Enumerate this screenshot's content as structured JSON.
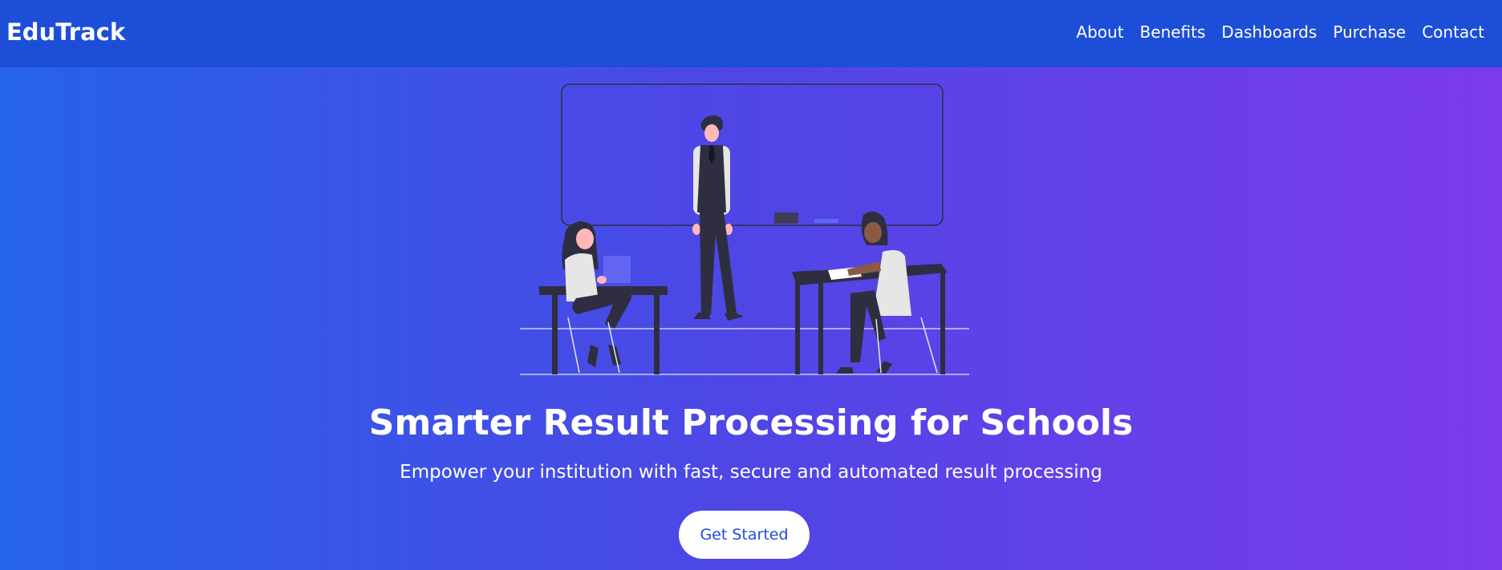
{
  "header": {
    "brand": "EduTrack",
    "nav": [
      "About",
      "Benefits",
      "Dashboards",
      "Purchase",
      "Contact"
    ]
  },
  "hero": {
    "title": "Smarter Result Processing for Schools",
    "subtitle": "Empower your institution with fast, secure and automated result processing",
    "cta_label": "Get Started",
    "illustration": "classroom-illustration"
  },
  "colors": {
    "nav_bg": "#1d4ed8",
    "gradient_start": "#2563eb",
    "gradient_end": "#7c3aed",
    "cta_text": "#1d4ed8"
  }
}
